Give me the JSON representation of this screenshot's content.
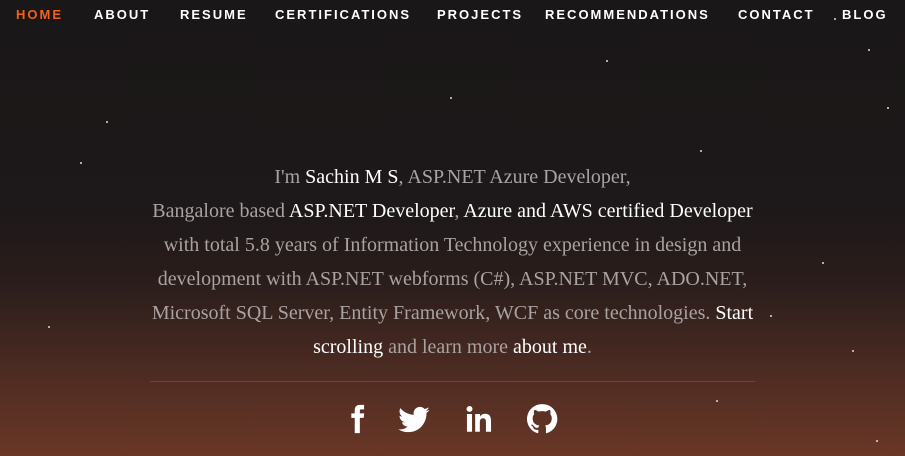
{
  "nav": {
    "items": [
      {
        "label": "HOME",
        "active": true
      },
      {
        "label": "ABOUT"
      },
      {
        "label": "RESUME"
      },
      {
        "label": "CERTIFICATIONS"
      },
      {
        "label": "PROJECTS"
      },
      {
        "label": "RECOMMENDATIONS"
      },
      {
        "label": "CONTACT"
      },
      {
        "label": "BLOG"
      }
    ]
  },
  "intro": {
    "l1_pre": "I'm ",
    "name": "Sachin M S",
    "l1_post": ", ASP.NET Azure Developer,",
    "l2_pre": "Bangalore based ",
    "l2_hl1": "ASP.NET Developer",
    "l2_sep": ", ",
    "l2_hl2": "Azure and AWS certified Developer",
    "l3": "with total 5.8 years of Information Technology experience in design and",
    "l4": "development with ASP.NET webforms (C#), ASP.NET MVC, ADO.NET,",
    "l5_pre": "Microsoft SQL Server, Entity Framework, WCF as core technologies. ",
    "l5_link": "Start",
    "l6_link": "scrolling",
    "l6_mid": " and learn more ",
    "l6_link2": "about me",
    "l6_end": "."
  },
  "social": {
    "icons": [
      "facebook-icon",
      "twitter-icon",
      "linkedin-icon",
      "github-icon"
    ]
  },
  "colors": {
    "accent": "#f2601b",
    "text_muted": "#a8a2a1",
    "text_highlight": "#ffffff"
  }
}
